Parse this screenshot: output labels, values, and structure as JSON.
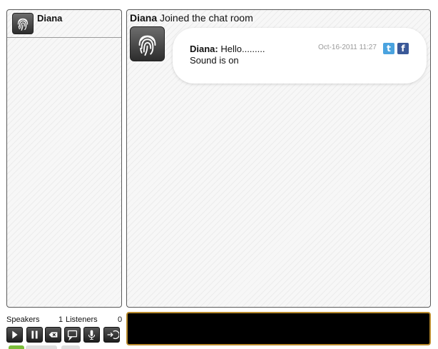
{
  "users_panel": {
    "users": [
      {
        "name": "Diana",
        "avatar_icon": "fingerprint-icon"
      }
    ]
  },
  "chat": {
    "join_notice": {
      "user": "Diana",
      "text": " Joined the chat room"
    },
    "messages": [
      {
        "author": "Diana:",
        "text": " Hello.........",
        "line2": "Sound is on",
        "timestamp": "Oct-16-2011 11:27",
        "avatar_icon": "fingerprint-icon",
        "share_icons": [
          "twitter-icon",
          "facebook-icon"
        ]
      }
    ]
  },
  "footer": {
    "speakers_label": "Speakers",
    "speakers_count": "1",
    "listeners_label": "Listeners",
    "listeners_count": "0",
    "controls": [
      "play-icon",
      "pause-icon",
      "clear-icon",
      "chat-bubble-icon",
      "microphone-icon",
      "logout-icon"
    ]
  },
  "colors": {
    "input_bg": "#000000",
    "input_border": "#b88a2c",
    "twitter": "#4aa3df",
    "facebook": "#3b5998"
  }
}
